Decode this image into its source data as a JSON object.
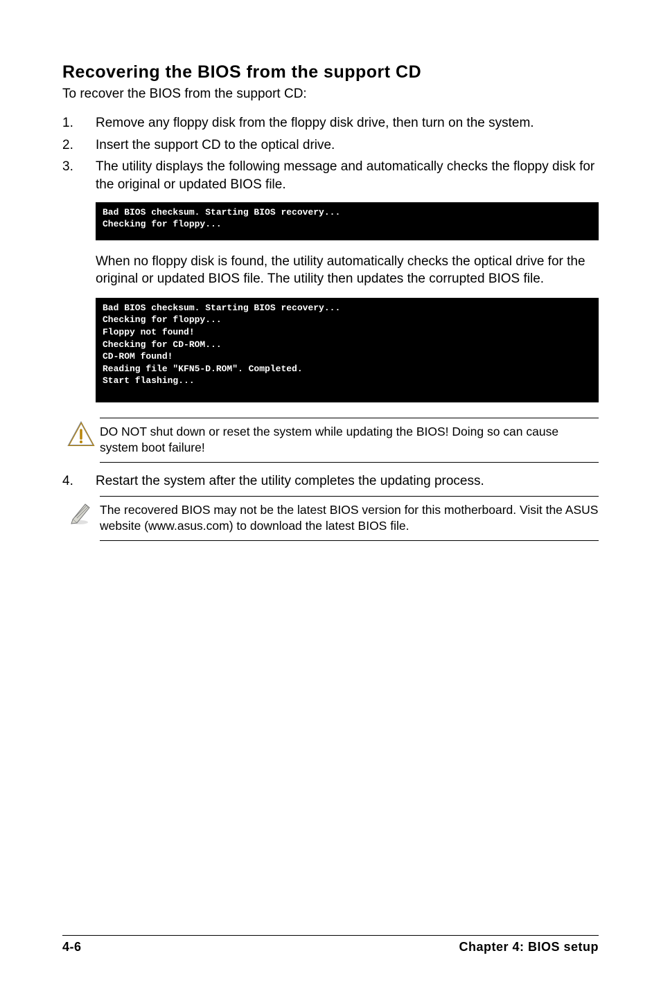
{
  "heading": "Recovering the BIOS from the support CD",
  "intro": "To recover the BIOS from the support CD:",
  "steps": [
    {
      "num": "1.",
      "text": "Remove any floppy disk from the floppy disk drive, then turn on the system."
    },
    {
      "num": "2.",
      "text": "Insert the support CD to the optical drive."
    },
    {
      "num": "3.",
      "text": "The utility displays the following message and automatically checks the floppy disk for the original or updated BIOS file."
    }
  ],
  "terminal1": "Bad BIOS checksum. Starting BIOS recovery...\nChecking for floppy...",
  "para_between": "When no floppy disk is found, the utility automatically checks the optical drive for the original or updated BIOS file. The utility then updates the corrupted BIOS file.",
  "terminal2": "Bad BIOS checksum. Starting BIOS recovery...\nChecking for floppy...\nFloppy not found!\nChecking for CD-ROM...\nCD-ROM found!\nReading file \"KFN5-D.ROM\". Completed.\nStart flashing...",
  "warning_note": "DO NOT shut down or reset the system while updating the BIOS! Doing so can cause system boot failure!",
  "step4": {
    "num": "4.",
    "text": "Restart the system after the utility completes the updating process."
  },
  "info_note": "The recovered BIOS may not be the latest BIOS version for this motherboard. Visit the ASUS website (www.asus.com) to download the latest BIOS file.",
  "footer_left": "4-6",
  "footer_right": "Chapter 4: BIOS setup"
}
